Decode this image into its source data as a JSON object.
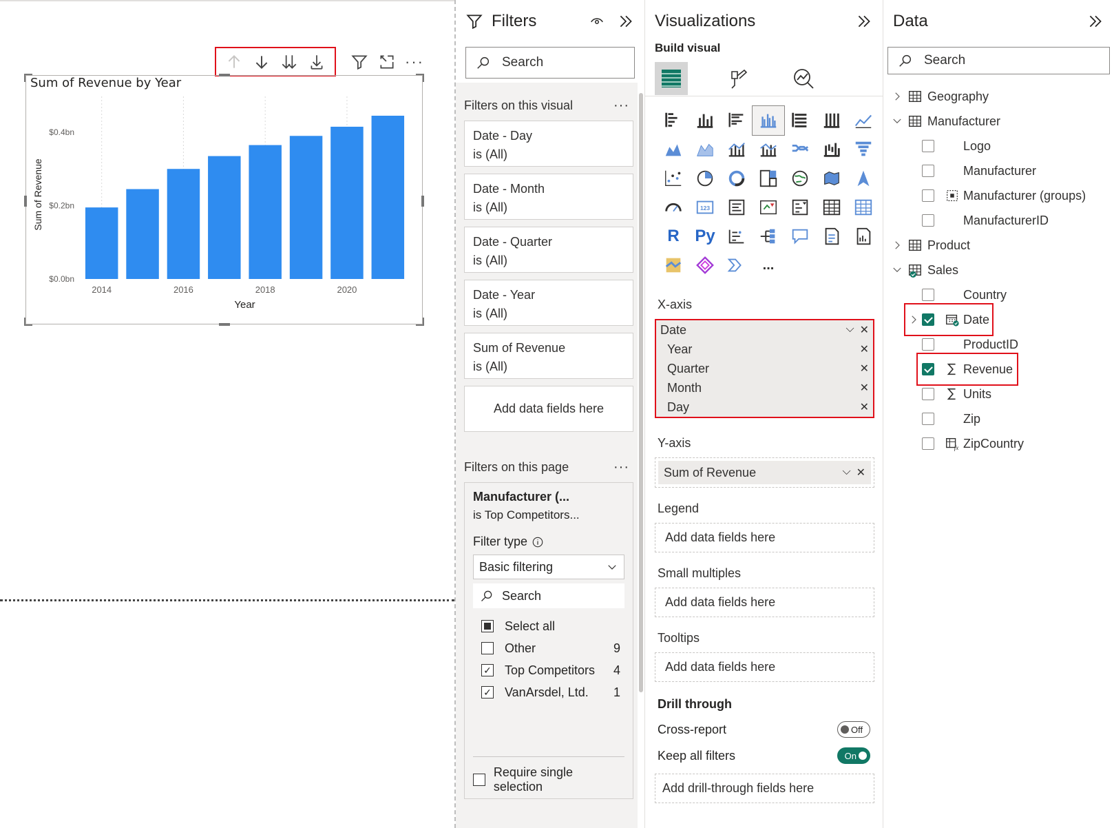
{
  "chart": {
    "title": "Sum of Revenue by Year",
    "toolbar": [
      "drill-up",
      "drill-down",
      "expand-next-level",
      "expand-all-down",
      "filter",
      "focus-mode",
      "more-options"
    ]
  },
  "chart_data": {
    "type": "bar",
    "title": "Sum of Revenue by Year",
    "xlabel": "Year",
    "ylabel": "Sum of Revenue",
    "categories": [
      "2014",
      "2015",
      "2016",
      "2017",
      "2018",
      "2019",
      "2020",
      "2021"
    ],
    "x_tick_labels": [
      "2014",
      "2016",
      "2018",
      "2020"
    ],
    "values": [
      0.195,
      0.245,
      0.3,
      0.335,
      0.365,
      0.39,
      0.415,
      0.445
    ],
    "y_unit": "bn",
    "y_tick_labels": [
      "$0.0bn",
      "$0.2bn",
      "$0.4bn"
    ],
    "y_ticks": [
      0,
      0.2,
      0.4
    ],
    "ylim": [
      0,
      0.46
    ],
    "bar_color": "#2f8cf0",
    "grid": "vertical dotted"
  },
  "filters": {
    "title": "Filters",
    "search_placeholder": "Search",
    "visual_section": "Filters on this visual",
    "visual_cards": [
      {
        "name": "Date - Day",
        "state": "is (All)"
      },
      {
        "name": "Date - Month",
        "state": "is (All)"
      },
      {
        "name": "Date - Quarter",
        "state": "is (All)"
      },
      {
        "name": "Date - Year",
        "state": "is (All)"
      },
      {
        "name": "Sum of Revenue",
        "state": "is (All)"
      }
    ],
    "add_fields": "Add data fields here",
    "page_section": "Filters on this page",
    "page_filter": {
      "title": "Manufacturer (...",
      "subtitle": "is Top Competitors...",
      "filter_type_label": "Filter type",
      "filter_type_value": "Basic filtering",
      "search_placeholder": "Search",
      "items": [
        {
          "label": "Select all",
          "count": "",
          "state": "partial"
        },
        {
          "label": "Other",
          "count": "9",
          "state": "unchecked"
        },
        {
          "label": "Top Competitors",
          "count": "4",
          "state": "checked"
        },
        {
          "label": "VanArsdel, Ltd.",
          "count": "1",
          "state": "checked"
        }
      ],
      "require_single": "Require single selection"
    }
  },
  "visualizations": {
    "title": "Visualizations",
    "build_label": "Build visual",
    "x_axis_label": "X-axis",
    "x_axis_fields": {
      "parent": "Date",
      "children": [
        "Year",
        "Quarter",
        "Month",
        "Day"
      ]
    },
    "y_axis_label": "Y-axis",
    "y_axis_field": "Sum of Revenue",
    "legend_label": "Legend",
    "small_multiples_label": "Small multiples",
    "tooltips_label": "Tooltips",
    "add_fields": "Add data fields here",
    "drill_title": "Drill through",
    "cross_report_label": "Cross-report",
    "cross_report_state": "Off",
    "keep_filters_label": "Keep all filters",
    "keep_filters_state": "On",
    "add_drill": "Add drill-through fields here",
    "more_visuals": "...",
    "r_visual": "R",
    "py_visual": "Py"
  },
  "data": {
    "title": "Data",
    "search_placeholder": "Search",
    "tree": [
      {
        "label": "Geography",
        "kind": "table",
        "expanded": false
      },
      {
        "label": "Manufacturer",
        "kind": "table",
        "expanded": true,
        "children": [
          {
            "label": "Logo",
            "checked": false
          },
          {
            "label": "Manufacturer",
            "checked": false
          },
          {
            "label": "Manufacturer (groups)",
            "checked": false
          },
          {
            "label": "ManufacturerID",
            "checked": false
          }
        ]
      },
      {
        "label": "Product",
        "kind": "table",
        "expanded": false
      },
      {
        "label": "Sales",
        "kind": "table",
        "expanded": true,
        "children": [
          {
            "label": "Country",
            "checked": false
          },
          {
            "label": "Date",
            "checked": true
          },
          {
            "label": "ProductID",
            "checked": false
          },
          {
            "label": "Revenue",
            "checked": true
          },
          {
            "label": "Units",
            "checked": false
          },
          {
            "label": "Zip",
            "checked": false
          },
          {
            "label": "ZipCountry",
            "checked": false
          }
        ]
      }
    ]
  },
  "colors": {
    "accent": "#117865",
    "highlight": "#e0101a",
    "bar": "#2f8cf0"
  }
}
